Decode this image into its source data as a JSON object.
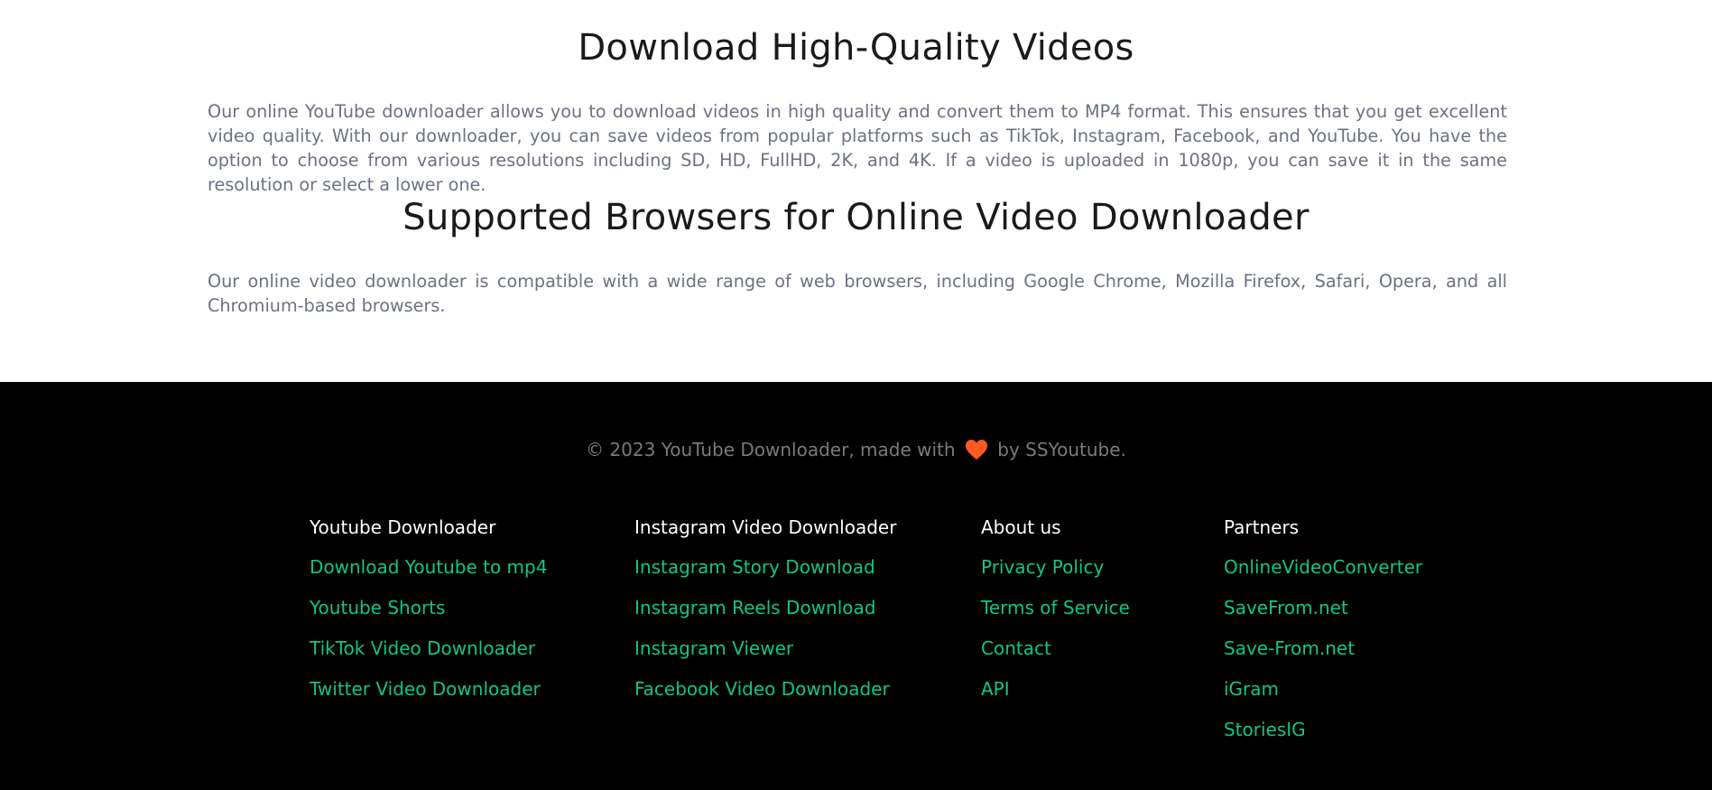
{
  "sections": [
    {
      "title": "Download High-Quality Videos",
      "body": "Our online YouTube downloader allows you to download videos in high quality and convert them to MP4 format. This ensures that you get excellent video quality. With our downloader, you can save videos from popular platforms such as TikTok, Instagram, Facebook, and YouTube. You have the option to choose from various resolutions including SD, HD, FullHD, 2K, and 4K. If a video is uploaded in 1080p, you can save it in the same resolution or select a lower one."
    },
    {
      "title": "Supported Browsers for Online Video Downloader",
      "body": "Our online video downloader is compatible with a wide range of web browsers, including Google Chrome, Mozilla Firefox, Safari, Opera, and all Chromium-based browsers."
    }
  ],
  "footer": {
    "copyright_prefix": "© 2023 YouTube Downloader, made with",
    "copyright_suffix": "by SSYoutube.",
    "heart_icon": "heart-icon",
    "heart_color": "#ff5a1f",
    "link_color": "#10c48a",
    "columns": [
      {
        "heading": "Youtube Downloader",
        "links": [
          "Download Youtube to mp4",
          "Youtube Shorts",
          "TikTok Video Downloader",
          "Twitter Video Downloader"
        ]
      },
      {
        "heading": "Instagram Video Downloader",
        "links": [
          "Instagram Story Download",
          "Instagram Reels Download",
          "Instagram Viewer",
          "Facebook Video Downloader"
        ]
      },
      {
        "heading": "About us",
        "links": [
          "Privacy Policy",
          "Terms of Service",
          "Contact",
          "API"
        ]
      },
      {
        "heading": "Partners",
        "links": [
          "OnlineVideoConverter",
          "SaveFrom.net",
          "Save-From.net",
          "iGram",
          "StoriesIG"
        ]
      }
    ]
  }
}
